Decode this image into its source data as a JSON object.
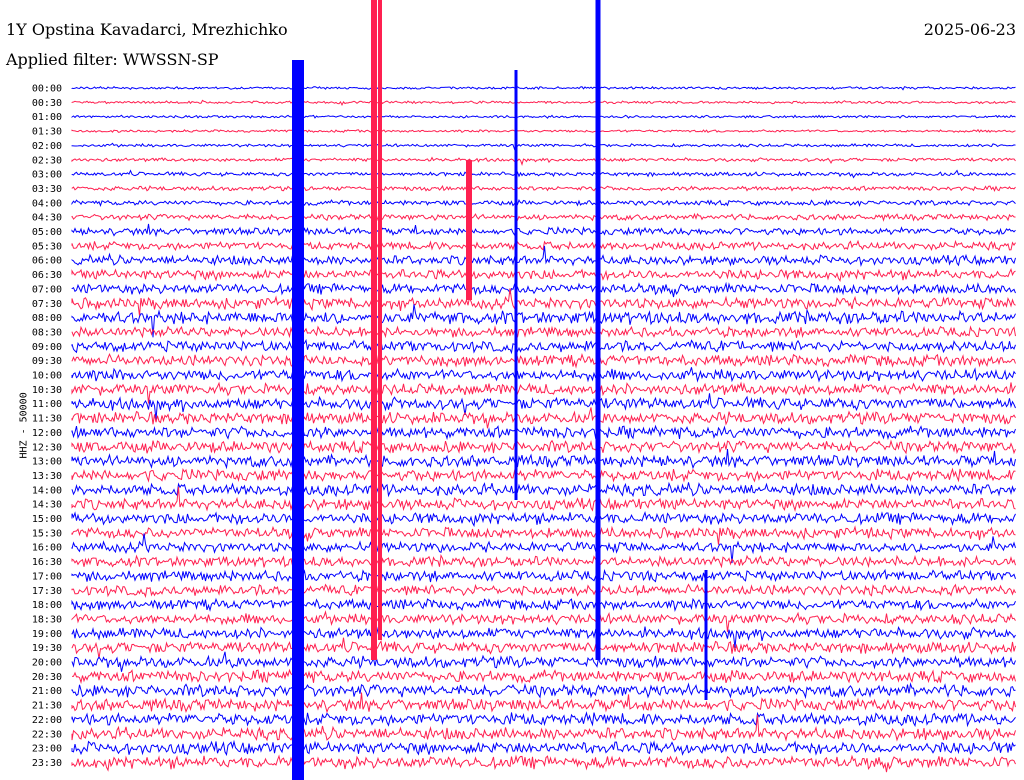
{
  "header": {
    "station": "1Y Opstina Kavadarci, Mrezhichko",
    "filter": "Applied filter: WWSSN-SP",
    "date": "2025-06-23"
  },
  "chart_data": {
    "type": "line",
    "ylabel": "HHZ - 50000",
    "row_labels": [
      "00:00",
      "00:30",
      "01:00",
      "01:30",
      "02:00",
      "02:30",
      "03:00",
      "03:30",
      "04:00",
      "04:30",
      "05:00",
      "05:30",
      "06:00",
      "06:30",
      "07:00",
      "07:30",
      "08:00",
      "08:30",
      "09:00",
      "09:30",
      "10:00",
      "10:30",
      "11:00",
      "11:30",
      "12:00",
      "12:30",
      "13:00",
      "13:30",
      "14:00",
      "14:30",
      "15:00",
      "15:30",
      "16:00",
      "16:30",
      "17:00",
      "17:30",
      "18:00",
      "18:30",
      "19:00",
      "19:30",
      "20:00",
      "20:30",
      "21:00",
      "21:30",
      "22:00",
      "22:30",
      "23:00",
      "23:30"
    ],
    "colors": {
      "even": "#0000ff",
      "odd": "#ff2050"
    },
    "noise_amplitude_by_row": [
      1,
      1,
      1,
      1,
      1.2,
      1.4,
      1.6,
      1.8,
      2,
      2.4,
      3,
      3.4,
      3.8,
      4,
      4.2,
      4.6,
      5.2,
      4,
      4.4,
      4.6,
      4.6,
      4.6,
      4.8,
      4.8,
      4.8,
      4.8,
      4.8,
      4.8,
      4.8,
      4.6,
      4.6,
      4.4,
      4.2,
      4.2,
      4.2,
      4.2,
      4.2,
      4.2,
      4.4,
      4.6,
      4.6,
      4.8,
      5,
      5,
      5,
      5,
      5,
      5
    ]
  }
}
